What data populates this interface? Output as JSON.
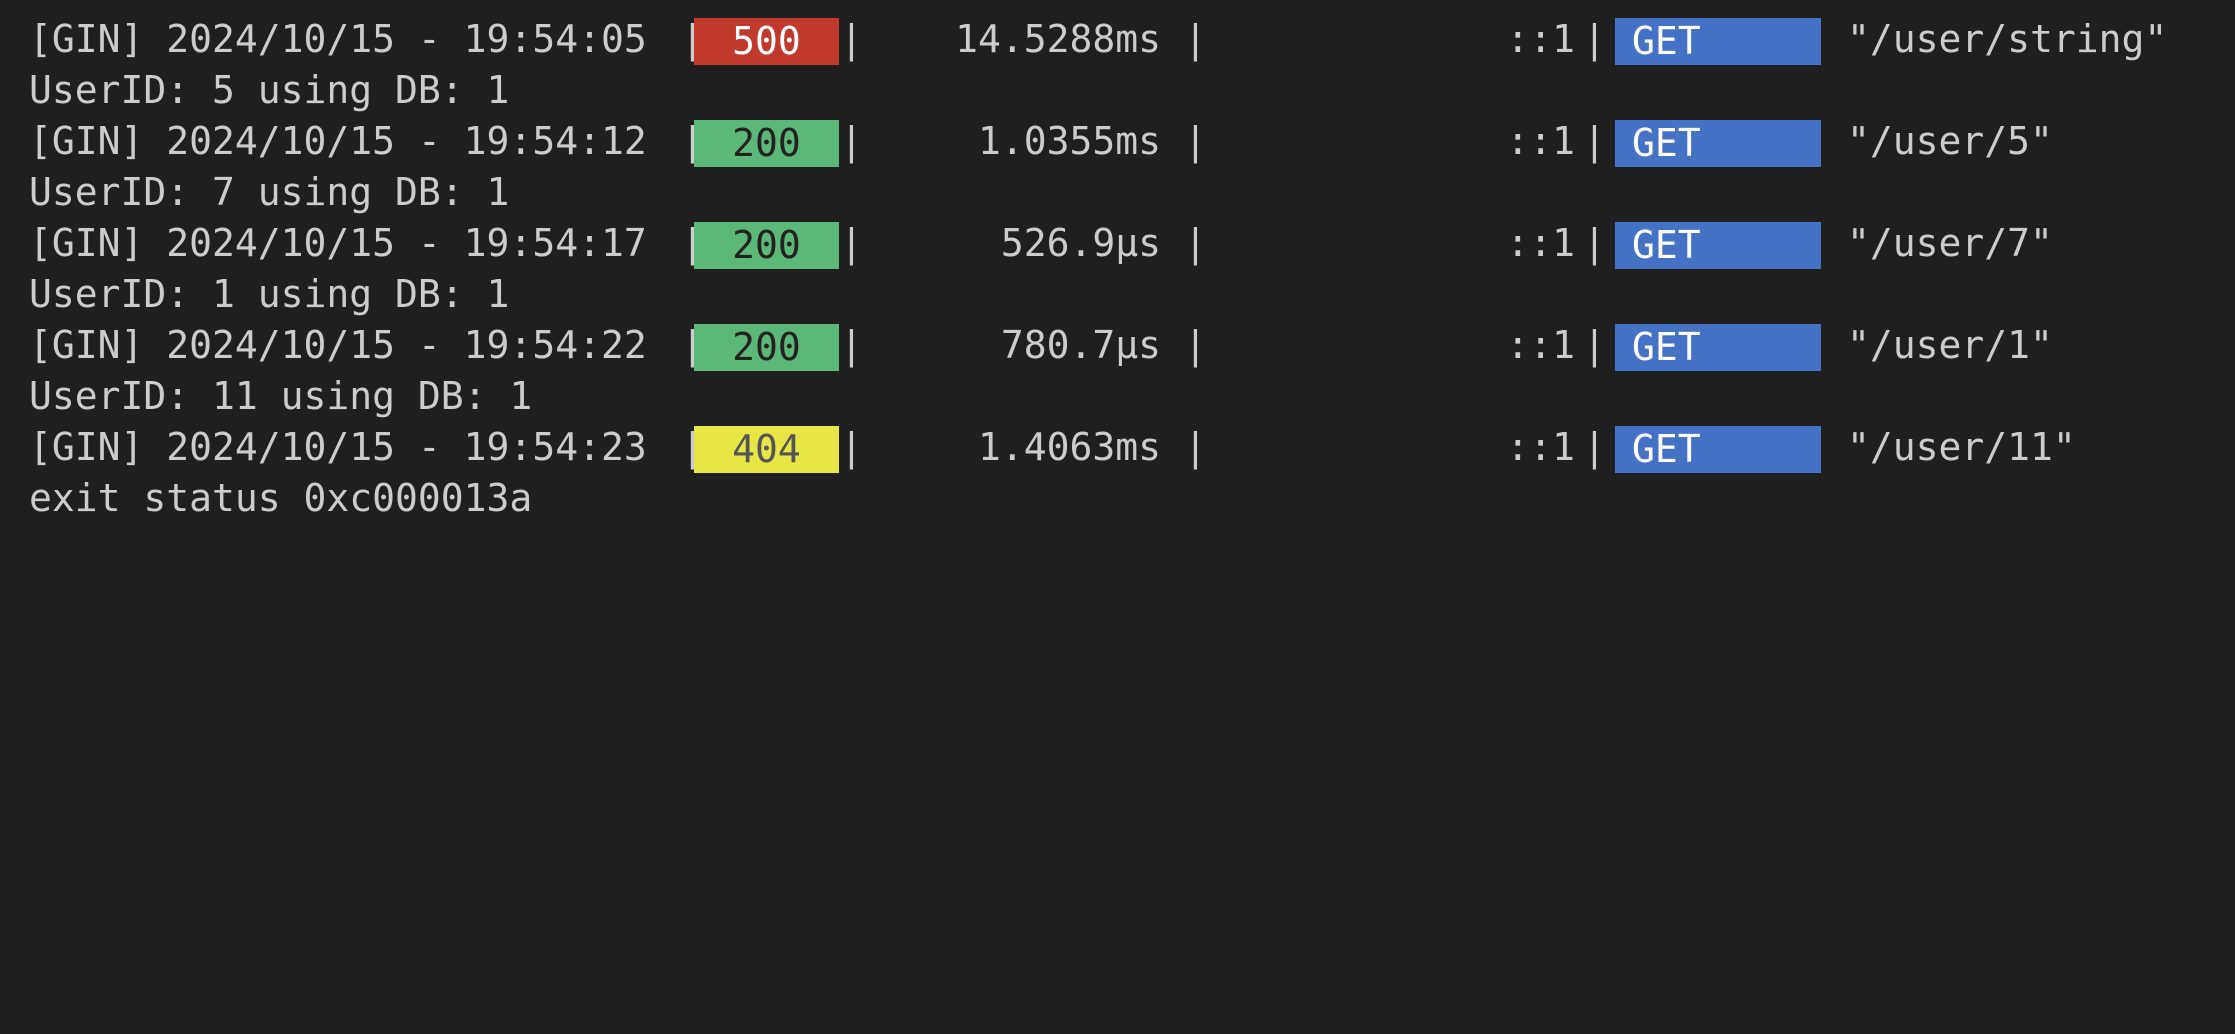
{
  "terminal": {
    "entries": [
      {
        "prefix": "[GIN] 2024/10/15 - 19:54:05 ",
        "status": "500",
        "status_color": "#c0392b",
        "latency": "14.5288ms",
        "ip": "::1",
        "method": "GET",
        "path": "\"/user/string\"",
        "message": "UserID: 5 using DB: 1"
      },
      {
        "prefix": "[GIN] 2024/10/15 - 19:54:12 ",
        "status": "200",
        "status_color": "#5cb878",
        "latency": "1.0355ms",
        "ip": "::1",
        "method": "GET",
        "path": "\"/user/5\"",
        "message": "UserID: 7 using DB: 1"
      },
      {
        "prefix": "[GIN] 2024/10/15 - 19:54:17 ",
        "status": "200",
        "status_color": "#5cb878",
        "latency": "526.9µs",
        "ip": "::1",
        "method": "GET",
        "path": "\"/user/7\"",
        "message": "UserID: 1 using DB: 1"
      },
      {
        "prefix": "[GIN] 2024/10/15 - 19:54:22 ",
        "status": "200",
        "status_color": "#5cb878",
        "latency": "780.7µs",
        "ip": "::1",
        "method": "GET",
        "path": "\"/user/1\"",
        "message": "UserID: 11 using DB: 1"
      },
      {
        "prefix": "[GIN] 2024/10/15 - 19:54:23 ",
        "status": "404",
        "status_color": "#e6e647",
        "latency": "1.4063ms",
        "ip": "::1",
        "method": "GET",
        "path": "\"/user/11\""
      }
    ],
    "separator": "|",
    "exit_message": "exit status 0xc000013a",
    "colors": {
      "background": "#1f1f1f",
      "text": "#cccccc",
      "method_badge": "#4472c4"
    }
  }
}
